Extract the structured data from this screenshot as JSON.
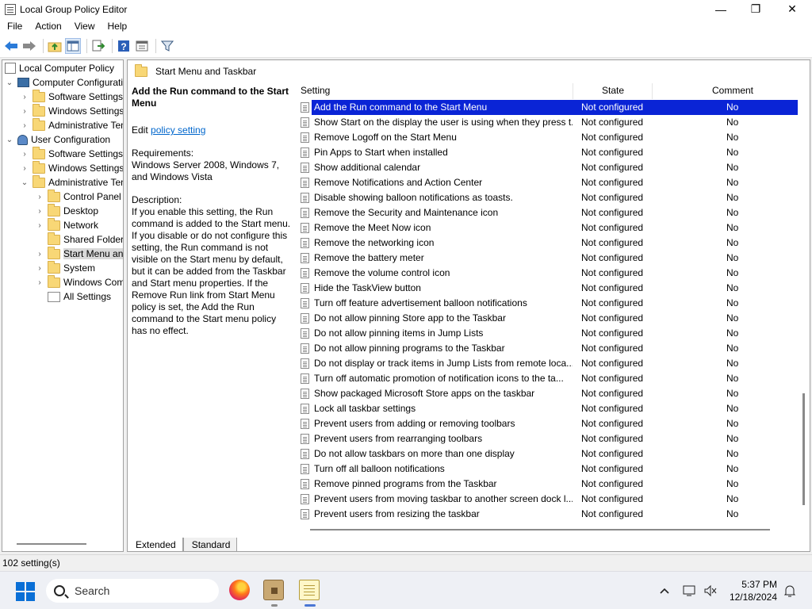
{
  "window": {
    "title": "Local Group Policy Editor",
    "controls": [
      "—",
      "❐",
      "✕"
    ]
  },
  "menu": [
    "File",
    "Action",
    "View",
    "Help"
  ],
  "toolbar": {
    "icons": [
      "back-arrow-icon",
      "forward-arrow-icon",
      "up-folder-icon",
      "show-hide-tree-icon",
      "export-list-icon",
      "help-icon",
      "properties-icon",
      "filter-icon"
    ]
  },
  "tree": {
    "items": [
      {
        "label": "Local Computer Policy",
        "level": 0,
        "expander": "",
        "icon": "policy-icon"
      },
      {
        "label": "Computer Configuration",
        "level": 0,
        "expander": "⌄",
        "icon": "computer-icon"
      },
      {
        "label": "Software Settings",
        "level": 1,
        "expander": "›",
        "icon": "folder-icon"
      },
      {
        "label": "Windows Settings",
        "level": 1,
        "expander": "›",
        "icon": "folder-icon"
      },
      {
        "label": "Administrative Templates",
        "level": 1,
        "expander": "›",
        "icon": "folder-icon"
      },
      {
        "label": "User Configuration",
        "level": 0,
        "expander": "⌄",
        "icon": "user-icon"
      },
      {
        "label": "Software Settings",
        "level": 1,
        "expander": "›",
        "icon": "folder-icon"
      },
      {
        "label": "Windows Settings",
        "level": 1,
        "expander": "›",
        "icon": "folder-icon"
      },
      {
        "label": "Administrative Templates",
        "level": 1,
        "expander": "⌄",
        "icon": "folder-icon"
      },
      {
        "label": "Control Panel",
        "level": 2,
        "expander": "›",
        "icon": "folder-icon"
      },
      {
        "label": "Desktop",
        "level": 2,
        "expander": "›",
        "icon": "folder-icon"
      },
      {
        "label": "Network",
        "level": 2,
        "expander": "›",
        "icon": "folder-icon"
      },
      {
        "label": "Shared Folders",
        "level": 2,
        "expander": "",
        "icon": "folder-icon"
      },
      {
        "label": "Start Menu and Taskbar",
        "level": 2,
        "expander": "›",
        "icon": "folder-icon",
        "selected": true
      },
      {
        "label": "System",
        "level": 2,
        "expander": "›",
        "icon": "folder-icon"
      },
      {
        "label": "Windows Components",
        "level": 2,
        "expander": "›",
        "icon": "folder-icon"
      },
      {
        "label": "All Settings",
        "level": 2,
        "expander": "",
        "icon": "all-settings-icon"
      }
    ]
  },
  "right_header": "Start Menu and Taskbar",
  "description": {
    "title": "Add the Run command to the Start Menu",
    "edit_prefix": "Edit ",
    "edit_link": "policy setting ",
    "requirements_label": "Requirements:",
    "requirements": "Windows Server 2008, Windows 7, and Windows Vista",
    "description_label": "Description:",
    "description": "If you enable this setting, the Run command is added to the Start menu.  If you disable or do not configure this setting, the Run command is not visible on the Start menu by default, but it can be added from the Taskbar and Start menu properties. If the Remove Run link from Start Menu policy is set, the Add the Run command to the Start menu policy has no effect."
  },
  "columns": {
    "setting": "Setting",
    "state": "State",
    "comment": "Comment"
  },
  "settings": [
    {
      "name": "Add the Run command to the Start Menu",
      "state": "Not configured",
      "comment": "No",
      "selected": true
    },
    {
      "name": "Show Start on the display the user is using when they press t...",
      "state": "Not configured",
      "comment": "No"
    },
    {
      "name": "Remove Logoff on the Start Menu",
      "state": "Not configured",
      "comment": "No"
    },
    {
      "name": "Pin Apps to Start when installed",
      "state": "Not configured",
      "comment": "No"
    },
    {
      "name": "Show additional calendar",
      "state": "Not configured",
      "comment": "No"
    },
    {
      "name": "Remove Notifications and Action Center",
      "state": "Not configured",
      "comment": "No"
    },
    {
      "name": "Disable showing balloon notifications as toasts.",
      "state": "Not configured",
      "comment": "No"
    },
    {
      "name": "Remove the Security and Maintenance icon",
      "state": "Not configured",
      "comment": "No"
    },
    {
      "name": "Remove the Meet Now icon",
      "state": "Not configured",
      "comment": "No"
    },
    {
      "name": "Remove the networking icon",
      "state": "Not configured",
      "comment": "No"
    },
    {
      "name": "Remove the battery meter",
      "state": "Not configured",
      "comment": "No"
    },
    {
      "name": "Remove the volume control icon",
      "state": "Not configured",
      "comment": "No"
    },
    {
      "name": "Hide the TaskView button",
      "state": "Not configured",
      "comment": "No"
    },
    {
      "name": "Turn off feature advertisement balloon notifications",
      "state": "Not configured",
      "comment": "No"
    },
    {
      "name": "Do not allow pinning Store app to the Taskbar",
      "state": "Not configured",
      "comment": "No"
    },
    {
      "name": "Do not allow pinning items in Jump Lists",
      "state": "Not configured",
      "comment": "No"
    },
    {
      "name": "Do not allow pinning programs to the Taskbar",
      "state": "Not configured",
      "comment": "No"
    },
    {
      "name": "Do not display or track items in Jump Lists from remote loca...",
      "state": "Not configured",
      "comment": "No"
    },
    {
      "name": "Turn off automatic promotion of notification icons to the ta...",
      "state": "Not configured",
      "comment": "No"
    },
    {
      "name": "Show packaged Microsoft Store apps on the taskbar",
      "state": "Not configured",
      "comment": "No"
    },
    {
      "name": "Lock all taskbar settings",
      "state": "Not configured",
      "comment": "No"
    },
    {
      "name": "Prevent users from adding or removing toolbars",
      "state": "Not configured",
      "comment": "No"
    },
    {
      "name": "Prevent users from rearranging toolbars",
      "state": "Not configured",
      "comment": "No"
    },
    {
      "name": "Do not allow taskbars on more than one display",
      "state": "Not configured",
      "comment": "No"
    },
    {
      "name": "Turn off all balloon notifications",
      "state": "Not configured",
      "comment": "No"
    },
    {
      "name": "Remove pinned programs from the Taskbar",
      "state": "Not configured",
      "comment": "No"
    },
    {
      "name": "Prevent users from moving taskbar to another screen dock l...",
      "state": "Not configured",
      "comment": "No"
    },
    {
      "name": "Prevent users from resizing the taskbar",
      "state": "Not configured",
      "comment": "No"
    }
  ],
  "tabs": [
    "Extended",
    "Standard"
  ],
  "status": "102 setting(s)",
  "taskbar": {
    "search_placeholder": "Search",
    "apps": [
      "firefox-icon",
      "group-policy-icon",
      "notepad-icon"
    ],
    "time": "5:37 PM",
    "date": "12/18/2024"
  },
  "colors": {
    "selection": "#0a24d6",
    "link": "#0066cc",
    "folder": "#f8d776",
    "start": "#0a6fd6"
  }
}
